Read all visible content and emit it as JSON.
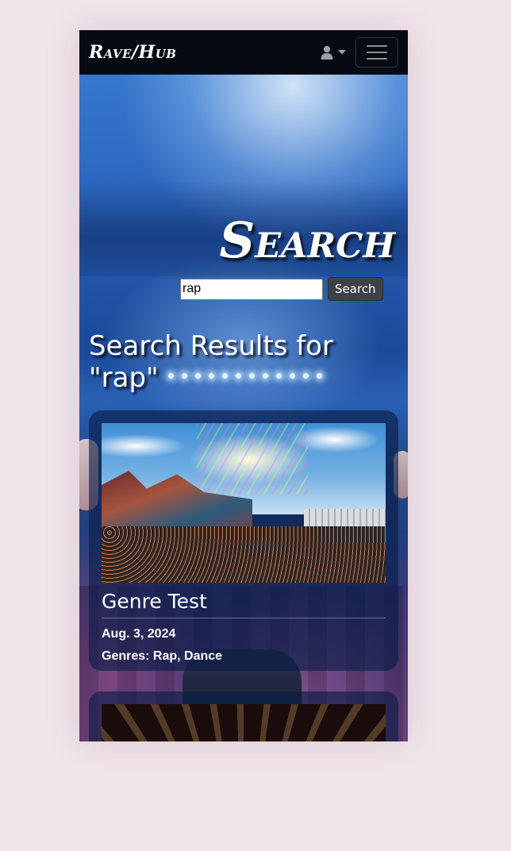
{
  "navbar": {
    "brand": "Rave/Hub",
    "user_menu_icon": "user-icon",
    "caret_icon": "caret-down-icon",
    "menu_icon": "hamburger-menu-icon"
  },
  "page": {
    "title": "Search"
  },
  "search": {
    "value": "rap",
    "button_label": "Search"
  },
  "results": {
    "heading": "Search Results for \"rap\"",
    "items": [
      {
        "title": "Genre Test",
        "date": "Aug. 3, 2024",
        "genres": "Genres: Rap, Dance"
      }
    ]
  },
  "colors": {
    "page_background": "#f1e4ea",
    "navbar_background": "#050b10",
    "card_background": "rgba(8, 28, 70, 0.62)",
    "button_background": "#3d4248"
  }
}
